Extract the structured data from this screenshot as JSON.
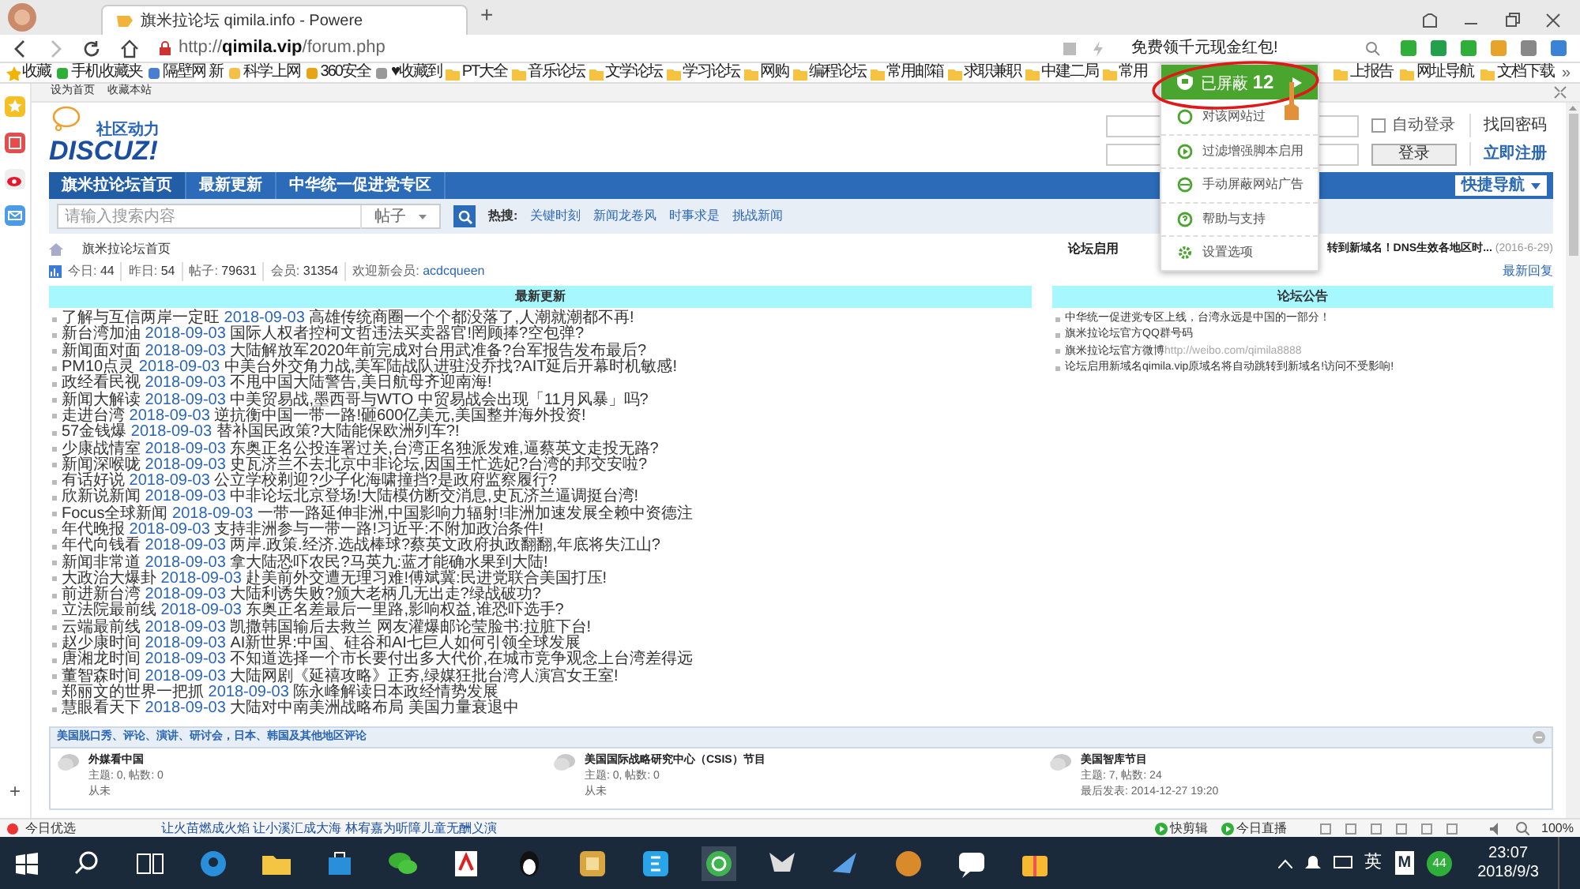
{
  "browser": {
    "tab_title": "旗米拉论坛 qimila.info - Powere",
    "new_tab": "+",
    "url_host": "http://",
    "url_domain": "qimila.vip",
    "url_path": "/forum.php",
    "search_placeholder": "免费领千元现金红包!",
    "bookmarks": [
      "收藏",
      "手机收藏夹",
      "隔壁网 新",
      "科学上网",
      "360安全",
      "♥收藏到",
      "PT大全",
      "音乐论坛",
      "文学论坛",
      "学习论坛",
      "网购",
      "编程论坛",
      "常用邮箱",
      "求职兼职",
      "中建二局",
      "常用",
      "上报告",
      "网址导航",
      "文档下载"
    ],
    "bookmarks_more": "»"
  },
  "sidebar_add": "+",
  "adblock_menu": {
    "header": "已屏蔽",
    "count": "12",
    "items": [
      {
        "label": "对该网站过",
        "kind": "circle"
      },
      {
        "label": "过滤增强脚本启用",
        "kind": "play"
      },
      {
        "label": "手动屏蔽网站广告",
        "kind": "eye"
      },
      {
        "label": "帮助与支持",
        "kind": "help"
      },
      {
        "label": "设置选项",
        "kind": "gear"
      }
    ]
  },
  "forum": {
    "top_links": [
      "设为首页",
      "收藏本站"
    ],
    "logo_tagline": "社区动力",
    "logo_text": "DISCUZ!",
    "login": {
      "auto_login": "自动登录",
      "auto_login_checked": false,
      "forgot": "找回密码",
      "login_button": "登录",
      "register": "立即注册"
    },
    "nav": [
      {
        "label": "旗米拉论坛首页",
        "selected": true
      },
      {
        "label": "最新更新",
        "selected": false
      },
      {
        "label": "中华统一促进党专区",
        "selected": false
      }
    ],
    "quick_nav": "快捷导航",
    "search": {
      "placeholder": "请输入搜索内容",
      "scope": "帖子",
      "hot_label": "热搜:",
      "hot": [
        "关键时刻",
        "新闻龙卷风",
        "时事求是",
        "挑战新闻"
      ]
    },
    "breadcrumb": "旗米拉论坛首页",
    "stats": [
      {
        "label": "今日:",
        "value": "44"
      },
      {
        "label": "昨日:",
        "value": "54"
      },
      {
        "label": "帖子:",
        "value": "79631"
      },
      {
        "label": "会员:",
        "value": "31354"
      },
      {
        "label": "欢迎新会员:",
        "value": "acdcqueen"
      }
    ],
    "announcement": {
      "start": "论坛启用",
      "end": "转到新域名！DNS生效各地区时...",
      "date": "(2016-6-29)"
    },
    "latest_replies": "最新回复",
    "latest_updates": {
      "title": "最新更新",
      "items": [
        {
          "source": "了解与互信两岸一定旺",
          "date": "2018-09-03",
          "title": "高雄传统商圈一个个都没落了,人潮就潮都不再!"
        },
        {
          "source": "新台湾加油",
          "date": "2018-09-03",
          "title": "国际人权者控柯文哲违法买卖器官!罔顾捧?空包弹?"
        },
        {
          "source": "新闻面对面",
          "date": "2018-09-03",
          "title": "大陆解放军2020年前完成对台用武准备?台军报告发布最后?"
        },
        {
          "source": "PM10点灵",
          "date": "2018-09-03",
          "title": "中美台外交角力战,美军陆战队进驻没乔找?AIT延后开幕时机敏感!"
        },
        {
          "source": "政经看民视",
          "date": "2018-09-03",
          "title": "不甩中国大陆警告,美日航母齐迎南海!"
        },
        {
          "source": "新闻大解读",
          "date": "2018-09-03",
          "title": "中美贸易战,墨西哥与WTO 中贸易战会出现「11月风暴」吗?"
        },
        {
          "source": "走进台湾",
          "date": "2018-09-03",
          "title": "逆抗衡中国一带一路!砸600亿美元,美国整并海外投资!"
        },
        {
          "source": "57金钱爆",
          "date": "2018-09-03",
          "title": "替补国民政策?大陆能保欧洲列车?!"
        },
        {
          "source": "少康战情室",
          "date": "2018-09-03",
          "title": "东奥正名公投连署过关,台湾正名独派发难,逼蔡英文走投无路?"
        },
        {
          "source": "新闻深喉咙",
          "date": "2018-09-03",
          "title": "史瓦济兰不去北京中非论坛,因国王忙选妃?台湾的邦交安啦?"
        },
        {
          "source": "有话好说",
          "date": "2018-09-03",
          "title": "公立学校剃迎?少子化海啸撞挡?是政府监察履行?"
        },
        {
          "source": "欣新说新闻",
          "date": "2018-09-03",
          "title": "中非论坛北京登场!大陆模仿断交消息,史瓦济兰逼调挺台湾!"
        },
        {
          "source": "Focus全球新闻",
          "date": "2018-09-03",
          "title": "一带一路延伸非洲,中国影响力辐射!非洲加速发展全赖中资德注"
        },
        {
          "source": "年代晚报",
          "date": "2018-09-03",
          "title": "支持非洲参与一带一路!习近平:不附加政治条件!"
        },
        {
          "source": "年代向钱看",
          "date": "2018-09-03",
          "title": "两岸.政策.经济.选战棒球?蔡英文政府执政翻翻,年底将失江山?"
        },
        {
          "source": "新闻非常道",
          "date": "2018-09-03",
          "title": "拿大陆恐吓农民?马英九:蓝才能确水果到大陆!"
        },
        {
          "source": "大政治大爆卦",
          "date": "2018-09-03",
          "title": "赴美前外交遭无理习难!傅斌冀:民进党联合美国打压!"
        },
        {
          "source": "前进新台湾",
          "date": "2018-09-03",
          "title": "大陆利诱失败?颁大老柄几无出走?绿战破功?"
        },
        {
          "source": "立法院最前线",
          "date": "2018-09-03",
          "title": "东奥正名差最后一里路,影响权益,谁恐吓选手?"
        },
        {
          "source": "云端最前线",
          "date": "2018-09-03",
          "title": "凯撒韩国输后去救兰 网友灌爆邮论莹脸书:拉脏下台!"
        },
        {
          "source": "赵少康时间",
          "date": "2018-09-03",
          "title": "AI新世界:中国、硅谷和AI七巨人如何引领全球发展"
        },
        {
          "source": "唐湘龙时间",
          "date": "2018-09-03",
          "title": "不知道选择一个市长要付出多大代价,在城市竞争观念上台湾差得远"
        },
        {
          "source": "董智森时间",
          "date": "2018-09-03",
          "title": "大陆网剧《延禧攻略》正夯,绿媒狂批台湾人演宫女王室!"
        },
        {
          "source": "郑丽文的世界一把抓",
          "date": "2018-09-03",
          "title": "陈永峰解读日本政经情势发展"
        },
        {
          "source": "慧眼看天下",
          "date": "2018-09-03",
          "title": "大陆对中南美洲战略布局 美国力量衰退中"
        }
      ]
    },
    "notices": {
      "title": "论坛公告",
      "items": [
        {
          "text": "中华统一促进党专区上线，台湾永远是中国的一部分！"
        },
        {
          "text": "旗米拉论坛官方QQ群号码"
        },
        {
          "text": "旗米拉论坛官方微博",
          "link": "http://weibo.com/qimila8888"
        },
        {
          "text": "论坛启用新域名qimila.vip原域名将自动跳转到新域名!访问不受影响!"
        }
      ]
    },
    "category": {
      "title": "美国脱口秀、评论、演讲、研讨会，日本、韩国及其他地区评论",
      "forums": [
        {
          "name": "外媒看中国",
          "counts": "主题: 0, 帖数: 0",
          "last": "从未"
        },
        {
          "name": "美国国际战略研究中心（CSIS）节目",
          "counts": "主题: 0, 帖数: 0",
          "last": "从未"
        },
        {
          "name": "美国智库节目",
          "counts": "主题: 7, 帖数: 24",
          "last": "最后发表: 2014-12-27 19:20"
        }
      ]
    }
  },
  "status_bar": {
    "daily": "今日优选",
    "ticker": "让火苗燃成火焰 让小溪汇成大海 林宥嘉为听障儿童无酬义演",
    "right": [
      "快剪辑",
      "今日直播"
    ],
    "zoom": "100%"
  },
  "taskbar": {
    "ime": "英",
    "ime2": "M",
    "badge": "44",
    "time": "23:07",
    "date": "2018/9/3"
  }
}
